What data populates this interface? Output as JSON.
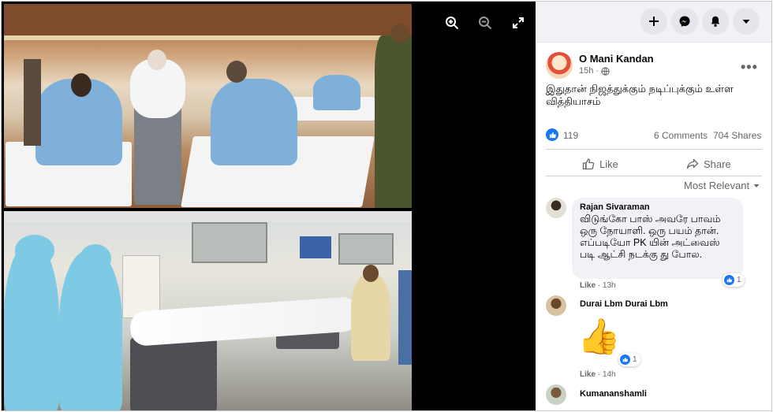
{
  "viewer": {
    "icons": [
      "zoom-in-icon",
      "zoom-out-icon",
      "fullscreen-icon"
    ]
  },
  "topbar": {
    "icons": [
      "plus-icon",
      "messenger-icon",
      "bell-icon",
      "caret-down-icon"
    ]
  },
  "post": {
    "author": "O Mani Kandan",
    "time": "15h ·",
    "caption": "இதுதான் நிஜத்துக்கும் நடிப்புக்கும் உள்ள வித்தியாசம்",
    "likes": "119",
    "comments": "6 Comments",
    "shares": "704 Shares",
    "like_label": "Like",
    "share_label": "Share",
    "sort_label": "Most Relevant"
  },
  "comments": [
    {
      "name": "Rajan Sivaraman",
      "text": "விடுங்கோ பாஸ் அவரே பாவம் ஒரு நோயாளி. ஒரு பயம் தான். எப்படியோ PK யின் அட்வைஸ் படி ஆட்சி நடக்கு து போல.",
      "like_label": "Like",
      "time": "13h",
      "reactions": "1"
    },
    {
      "name": "Durai Lbm Durai Lbm",
      "text": "👍",
      "like_label": "Like",
      "time": "14h",
      "reactions": "1"
    },
    {
      "name": "Kumananshamli"
    }
  ],
  "colors": {
    "accent": "#1877f2",
    "panel_bg": "#f0f2f5"
  }
}
